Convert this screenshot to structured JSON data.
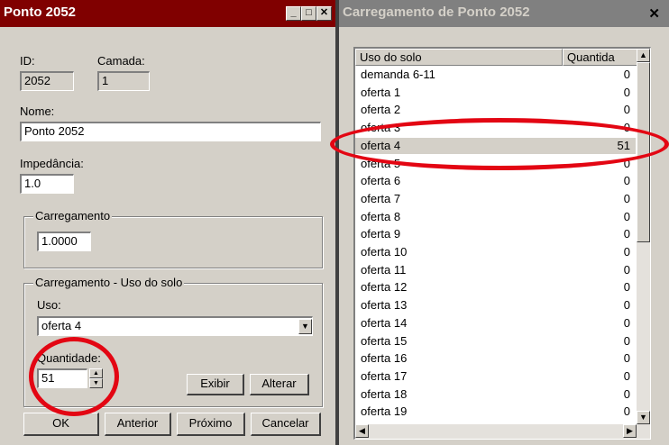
{
  "left_window": {
    "title": "Ponto 2052",
    "id_label": "ID:",
    "id_value": "2052",
    "camada_label": "Camada:",
    "camada_value": "1",
    "nome_label": "Nome:",
    "nome_value": "Ponto 2052",
    "impedancia_label": "Impedância:",
    "impedancia_value": "1.0",
    "carregamento_group": "Carregamento",
    "carregamento_value": "1.0000",
    "uso_group": "Carregamento - Uso do solo",
    "uso_label": "Uso:",
    "uso_value": "oferta 4",
    "quantidade_label": "Quantidade:",
    "quantidade_value": "51",
    "exibir_label": "Exibir",
    "alterar_label": "Alterar",
    "ok_label": "OK",
    "anterior_label": "Anterior",
    "proximo_label": "Próximo",
    "cancelar_label": "Cancelar"
  },
  "right_window": {
    "title": "Carregamento de Ponto 2052",
    "columns": [
      "Uso do solo",
      "Quantida"
    ],
    "rows": [
      {
        "name": "demanda 6-11",
        "qty": "0"
      },
      {
        "name": "oferta 1",
        "qty": "0"
      },
      {
        "name": "oferta 2",
        "qty": "0"
      },
      {
        "name": "oferta 3",
        "qty": "0"
      },
      {
        "name": "oferta 4",
        "qty": "51"
      },
      {
        "name": "oferta 5",
        "qty": "0"
      },
      {
        "name": "oferta 6",
        "qty": "0"
      },
      {
        "name": "oferta 7",
        "qty": "0"
      },
      {
        "name": "oferta 8",
        "qty": "0"
      },
      {
        "name": "oferta 9",
        "qty": "0"
      },
      {
        "name": "oferta 10",
        "qty": "0"
      },
      {
        "name": "oferta 11",
        "qty": "0"
      },
      {
        "name": "oferta 12",
        "qty": "0"
      },
      {
        "name": "oferta 13",
        "qty": "0"
      },
      {
        "name": "oferta 14",
        "qty": "0"
      },
      {
        "name": "oferta 15",
        "qty": "0"
      },
      {
        "name": "oferta 16",
        "qty": "0"
      },
      {
        "name": "oferta 17",
        "qty": "0"
      },
      {
        "name": "oferta 18",
        "qty": "0"
      },
      {
        "name": "oferta 19",
        "qty": "0"
      }
    ],
    "selected_row": 4
  },
  "colors": {
    "active_title": "#800000",
    "inactive_title": "#808080",
    "annotation_circle": "#e30613"
  }
}
